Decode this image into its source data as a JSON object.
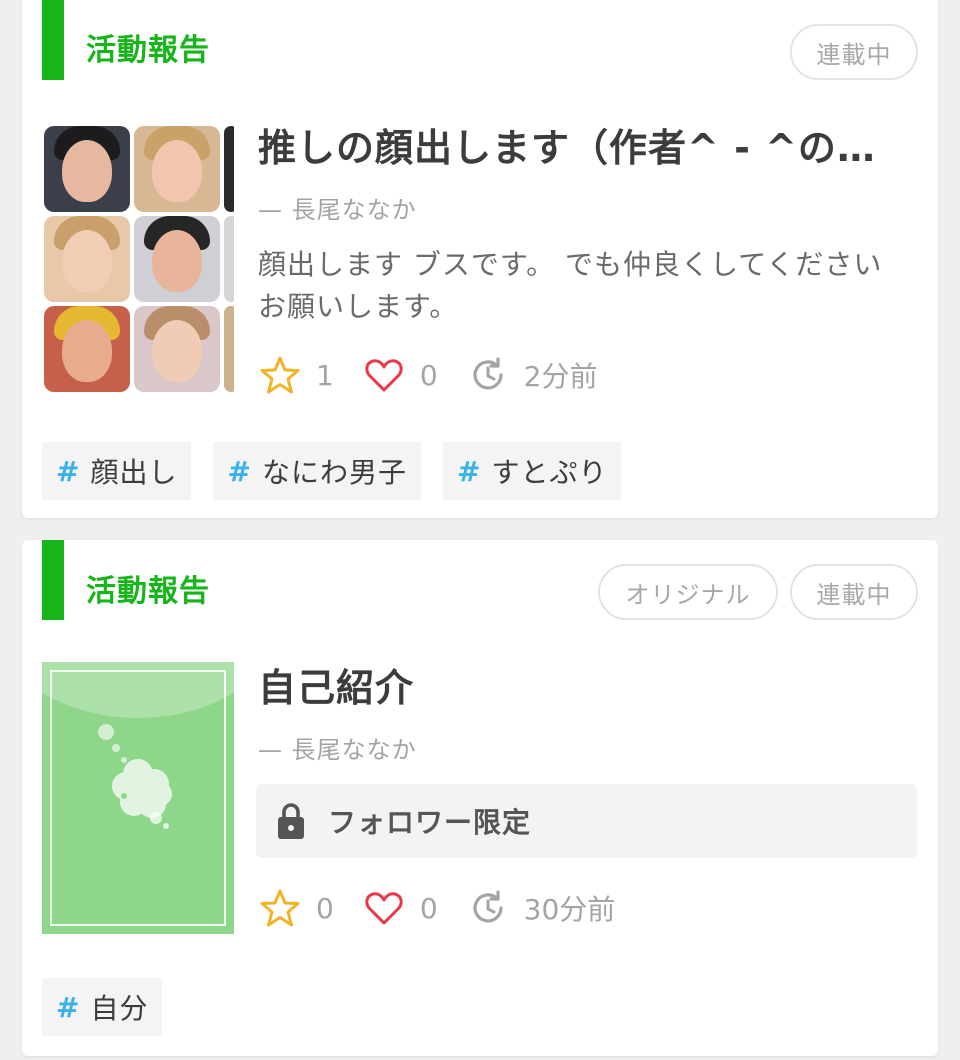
{
  "cards": [
    {
      "category": "活動報告",
      "badges": [
        "連載中"
      ],
      "title": "推しの顔出します（作者^ - ^の…",
      "author": "— 長尾ななか",
      "description": "顔出します ブスです。 でも仲良くしてください お願いします。",
      "stats": {
        "stars": "1",
        "likes": "0",
        "updated": "2分前"
      },
      "tags": [
        "顔出し",
        "なにわ男子",
        "すとぷり"
      ]
    },
    {
      "category": "活動報告",
      "badges": [
        "オリジナル",
        "連載中"
      ],
      "title": "自己紹介",
      "author": "— 長尾ななか",
      "locked_label": "フォロワー限定",
      "stats": {
        "stars": "0",
        "likes": "0",
        "updated": "30分前"
      },
      "tags": [
        "自分"
      ]
    }
  ],
  "tag_symbol": "#",
  "colors": {
    "accent_green": "#16b51a",
    "hashtag_blue": "#3ab2e8",
    "star_yellow": "#f0b429",
    "heart_red": "#e8394a"
  }
}
